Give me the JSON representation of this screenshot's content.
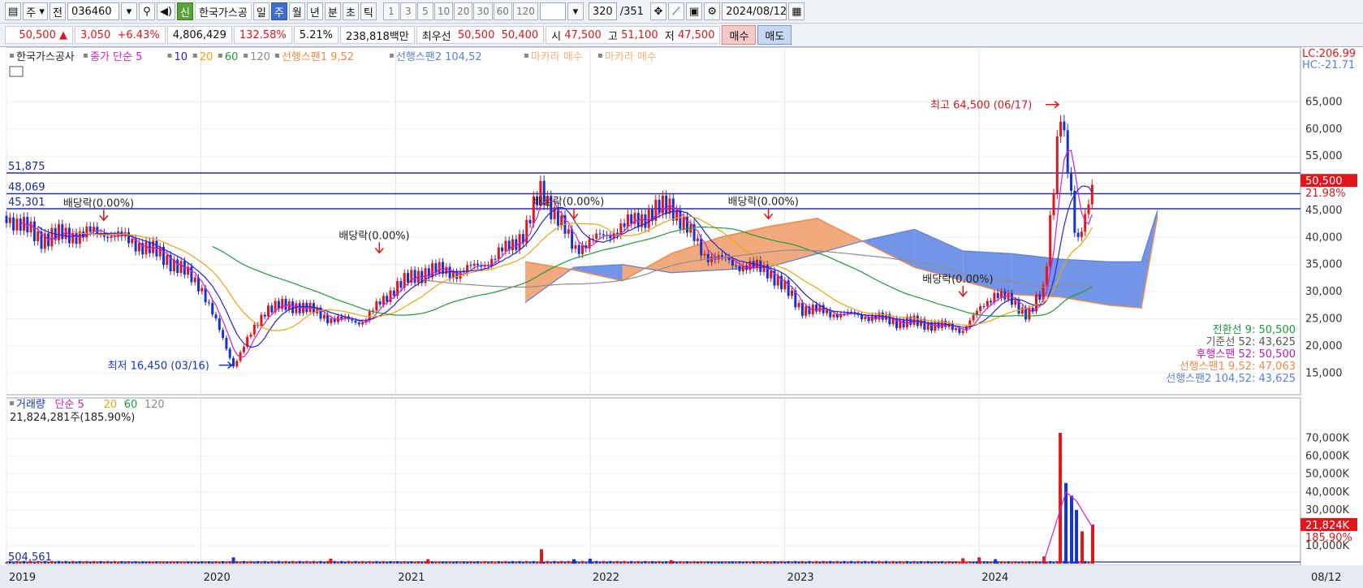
{
  "toolbar": {
    "period_select": "주",
    "prev_label": "전",
    "code": "036460",
    "new_badge": "신",
    "name": "한국가스공",
    "periods": [
      "일",
      "주",
      "월",
      "년",
      "분",
      "초",
      "틱"
    ],
    "active_period": "주",
    "intervals": [
      "1",
      "3",
      "5",
      "10",
      "20",
      "30",
      "60",
      "120"
    ],
    "count": "320",
    "total": "/351",
    "date": "2024/08/12"
  },
  "quote": {
    "price": "50,500",
    "arrow": "▲",
    "change": "3,050",
    "change_pct": "+6.43%",
    "volume": "4,806,429",
    "vol_ratio": "132.58%",
    "turnover": "5.21%",
    "amount": "238,818백만",
    "best_label": "최우선",
    "ask": "50,500",
    "bid": "50,400",
    "open_label": "시",
    "open": "47,500",
    "high_label": "고",
    "high": "51,100",
    "low_label": "저",
    "low": "47,500",
    "buy_label": "매수",
    "sell_label": "매도"
  },
  "colors": {
    "up": "#e0161b",
    "down": "#1433d6",
    "ma5": "#d11fd1",
    "ma10": "#2424d8",
    "ma20": "#f2a40c",
    "ma60": "#1f9a3a",
    "ma120": "#8c8c8c",
    "span1": "#f0a070",
    "span2": "#6b8fe6"
  },
  "chart_data": [
    {
      "type": "line",
      "panel": "price",
      "legend": [
        {
          "label": "한국가스공사",
          "color": "#222222"
        },
        {
          "label": "종가 단순 5",
          "color": "#d11fd1"
        },
        {
          "label": "10",
          "color": "#2424d8"
        },
        {
          "label": "20",
          "color": "#f2a40c"
        },
        {
          "label": "60",
          "color": "#1f9a3a"
        },
        {
          "label": "120",
          "color": "#8c8c8c"
        },
        {
          "label": "선행스팬1 9,52",
          "color": "#f08a4b"
        },
        {
          "label": "선행스팬2 104,52",
          "color": "#5b7fdb"
        },
        {
          "label": "마카라 매수",
          "color": "#f5b27a"
        },
        {
          "label": "마카라 매수",
          "color": "#f5b27a"
        }
      ],
      "x_labels": [
        "2019",
        "2020",
        "2021",
        "2022",
        "2023",
        "2024",
        "08/12"
      ],
      "y_ticks": [
        15000,
        20000,
        25000,
        30000,
        35000,
        40000,
        45000,
        50000,
        55000,
        60000,
        65000
      ],
      "y_tick_labels": [
        "15,000",
        "20,000",
        "25,000",
        "30,000",
        "35,000",
        "40,000",
        "45,000",
        "50,000",
        "55,000",
        "60,000",
        "65,000"
      ],
      "ylim": [
        11000,
        70000
      ],
      "hlines": [
        {
          "value": 51875,
          "label": "51,875"
        },
        {
          "value": 48069,
          "label": "48,069"
        },
        {
          "value": 45301,
          "label": "45,301"
        }
      ],
      "price_path": {
        "x": [
          "2019-01",
          "2019-03",
          "2019-05",
          "2019-07",
          "2019-09",
          "2019-11",
          "2020-01",
          "2020-03",
          "2020-05",
          "2020-07",
          "2020-09",
          "2020-11",
          "2021-01",
          "2021-03",
          "2021-05",
          "2021-07",
          "2021-09",
          "2021-10",
          "2021-12",
          "2022-02",
          "2022-04",
          "2022-06",
          "2022-08",
          "2022-10",
          "2022-12",
          "2023-02",
          "2023-04",
          "2023-06",
          "2023-08",
          "2023-10",
          "2023-12",
          "2024-02",
          "2024-04",
          "2024-05",
          "2024-06",
          "2024-07",
          "2024-08"
        ],
        "y": [
          44000,
          40000,
          40500,
          41000,
          39000,
          36000,
          31000,
          16450,
          27000,
          27500,
          25000,
          24500,
          31000,
          34000,
          33500,
          36000,
          41000,
          49000,
          38000,
          40500,
          43500,
          46000,
          37000,
          35000,
          34000,
          27000,
          26000,
          25500,
          24500,
          24000,
          23000,
          30000,
          26000,
          30000,
          64500,
          38000,
          50500
        ]
      },
      "ichimoku_cloud": [
        {
          "x": "2021-09",
          "span1": 35500,
          "span2": 28000
        },
        {
          "x": "2021-12",
          "span1": 34000,
          "span2": 34500
        },
        {
          "x": "2022-03",
          "span1": 32000,
          "span2": 35000
        },
        {
          "x": "2022-06",
          "span1": 37000,
          "span2": 33500
        },
        {
          "x": "2022-09",
          "span1": 40000,
          "span2": 34000
        },
        {
          "x": "2022-12",
          "span1": 42000,
          "span2": 34500
        },
        {
          "x": "2023-03",
          "span1": 43500,
          "span2": 37000
        },
        {
          "x": "2023-06",
          "span1": 39000,
          "span2": 39500
        },
        {
          "x": "2023-09",
          "span1": 34500,
          "span2": 41500
        },
        {
          "x": "2023-12",
          "span1": 32000,
          "span2": 37500
        },
        {
          "x": "2024-03",
          "span1": 29500,
          "span2": 37000
        },
        {
          "x": "2024-06",
          "span1": 29000,
          "span2": 36000
        },
        {
          "x": "2024-09",
          "span1": 27500,
          "span2": 35500
        },
        {
          "x": "2024-11",
          "span1": 27000,
          "span2": 35500
        },
        {
          "x": "2024-12",
          "span1": 44000,
          "span2": 45000
        }
      ],
      "annotations": [
        {
          "text": "배당락(0.00%)",
          "x": "2019-07",
          "y": 44500
        },
        {
          "text": "배당락(0.00%)",
          "x": "2020-12",
          "y": 38500
        },
        {
          "text": "배당락(0.00%)",
          "x": "2021-12",
          "y": 44800
        },
        {
          "text": "배당락(0.00%)",
          "x": "2022-12",
          "y": 44800
        },
        {
          "text": "배당락(0.00%)",
          "x": "2023-12",
          "y": 30500
        },
        {
          "text": "최고 64,500 (06/17)",
          "x": "2024-06",
          "y": 64500
        },
        {
          "text": "최저 16,450 (03/16)",
          "x": "2020-03",
          "y": 16450
        }
      ],
      "right_labels": [
        {
          "text": "LC:206.99",
          "color": "#e0161b"
        },
        {
          "text": "HC:-21.71",
          "color": "#5b7fdb"
        },
        {
          "text": "50,500",
          "color": "#e0161b"
        },
        {
          "text": "21.98%",
          "color": "#e0161b"
        }
      ],
      "indicator_values": [
        {
          "text": "전환선 9: 50,500",
          "color": "#1f9a3a"
        },
        {
          "text": "기준선 52: 43,625",
          "color": "#555555"
        },
        {
          "text": "후행스팬 52: 50,500",
          "color": "#c216c2"
        },
        {
          "text": "선행스팬1 9,52: 47,063",
          "color": "#f08a4b"
        },
        {
          "text": "선행스팬2 104,52: 43,625",
          "color": "#5b7fdb"
        }
      ]
    },
    {
      "type": "bar",
      "panel": "volume",
      "legend": [
        {
          "label": "거래량",
          "color": "#1433d6"
        },
        {
          "label": "단순 5",
          "color": "#d11fd1"
        },
        {
          "label": "20",
          "color": "#f2a40c"
        },
        {
          "label": "60",
          "color": "#1f9a3a"
        },
        {
          "label": "120",
          "color": "#8c8c8c"
        }
      ],
      "current_text": "21,824,281주(185.90%)",
      "y_ticks": [
        10000,
        20000,
        30000,
        40000,
        50000,
        60000,
        70000
      ],
      "y_tick_labels": [
        "10,000K",
        "20,000K",
        "30,000K",
        "40,000K",
        "50,000K",
        "60,000K",
        "70,000K"
      ],
      "ylim": [
        0,
        78000
      ],
      "base_label": "504,561",
      "right_labels": [
        {
          "text": "21,824K",
          "color": "#e0161b"
        },
        {
          "text": "185.90%",
          "color": "#e0161b"
        }
      ],
      "bars": [
        {
          "x": "2020-03",
          "value": 3500,
          "dir": "down"
        },
        {
          "x": "2020-09",
          "value": 2800,
          "dir": "up"
        },
        {
          "x": "2021-03",
          "value": 2500,
          "dir": "up"
        },
        {
          "x": "2021-10",
          "value": 8000,
          "dir": "up"
        },
        {
          "x": "2021-12",
          "value": 2500,
          "dir": "down"
        },
        {
          "x": "2022-01",
          "value": 2800,
          "dir": "down"
        },
        {
          "x": "2022-06",
          "value": 2000,
          "dir": "up"
        },
        {
          "x": "2023-12",
          "value": 3000,
          "dir": "up"
        },
        {
          "x": "2024-01",
          "value": 3500,
          "dir": "up"
        },
        {
          "x": "2024-02",
          "value": 2500,
          "dir": "down"
        },
        {
          "x": "2024-05",
          "value": 4000,
          "dir": "up"
        },
        {
          "x": "2024-06",
          "value": 73000,
          "dir": "up"
        },
        {
          "x": "2024-06b",
          "value": 45000,
          "dir": "down"
        },
        {
          "x": "2024-06c",
          "value": 38000,
          "dir": "down"
        },
        {
          "x": "2024-07",
          "value": 30000,
          "dir": "down"
        },
        {
          "x": "2024-07b",
          "value": 18000,
          "dir": "up"
        },
        {
          "x": "2024-08",
          "value": 21824,
          "dir": "up"
        }
      ]
    }
  ]
}
